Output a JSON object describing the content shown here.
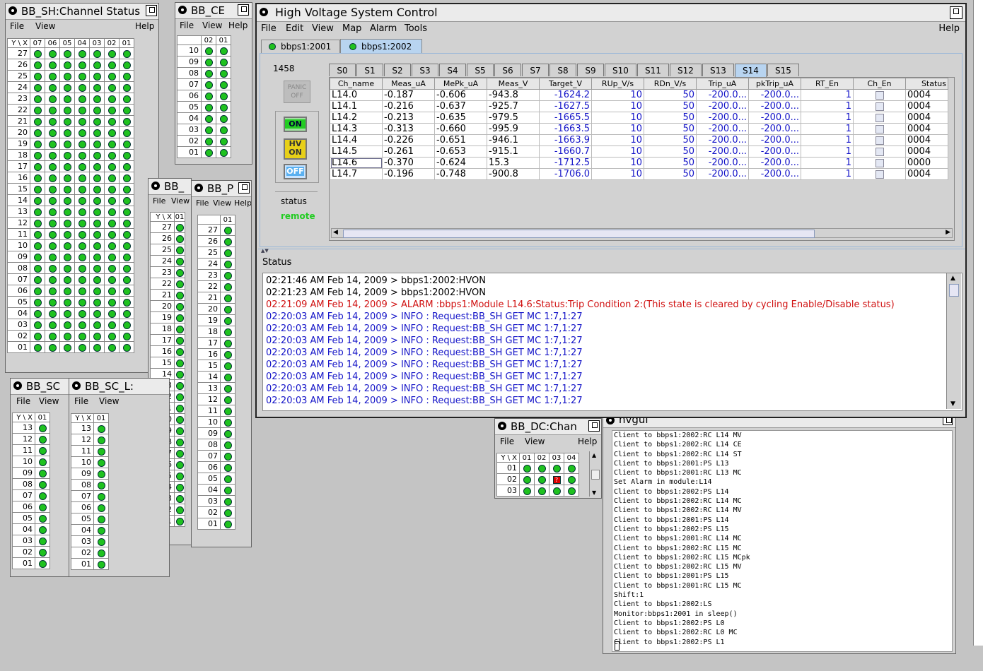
{
  "sh_window": {
    "title": "BB_SH:Channel Status",
    "menu": [
      "File",
      "View",
      "Help"
    ],
    "corner": "Y \\ X",
    "cols": [
      "07",
      "06",
      "05",
      "04",
      "03",
      "02",
      "01"
    ],
    "rows": [
      "27",
      "26",
      "25",
      "24",
      "23",
      "22",
      "21",
      "20",
      "19",
      "18",
      "17",
      "16",
      "15",
      "14",
      "13",
      "12",
      "11",
      "10",
      "09",
      "08",
      "07",
      "06",
      "05",
      "04",
      "03",
      "02",
      "01"
    ]
  },
  "ce_window": {
    "title": "BB_CE",
    "menu": [
      "File",
      "View",
      "Help"
    ],
    "cols": [
      "02",
      "01"
    ],
    "rows": [
      "10",
      "09",
      "08",
      "07",
      "06",
      "05",
      "04",
      "03",
      "02",
      "01"
    ]
  },
  "bb_a_window": {
    "title": "BB_",
    "menu": [
      "File",
      "View"
    ],
    "corner": "Y \\ X",
    "cols": [
      "01"
    ],
    "rows": [
      "27",
      "26",
      "25",
      "24",
      "23",
      "22",
      "21",
      "20",
      "19",
      "18",
      "17",
      "16",
      "15",
      "14",
      "13",
      "12",
      "11",
      "10",
      "09",
      "08",
      "07",
      "06",
      "05",
      "04",
      "03",
      "02",
      "01"
    ]
  },
  "bb_p_window": {
    "title": "BB_P",
    "menu": [
      "File",
      "View",
      "Help"
    ],
    "cols": [
      "01"
    ],
    "rows": [
      "27",
      "26",
      "25",
      "24",
      "23",
      "22",
      "21",
      "20",
      "19",
      "18",
      "17",
      "16",
      "15",
      "14",
      "13",
      "12",
      "11",
      "10",
      "09",
      "08",
      "07",
      "06",
      "05",
      "04",
      "03",
      "02",
      "01"
    ]
  },
  "sc_window": {
    "title": "BB_SC",
    "menu": [
      "File",
      "View"
    ],
    "corner": "Y \\ X",
    "cols": [
      "01"
    ],
    "rows": [
      "13",
      "12",
      "11",
      "10",
      "09",
      "08",
      "07",
      "06",
      "05",
      "04",
      "03",
      "02",
      "01"
    ]
  },
  "scl_window": {
    "title": "BB_SC_L:",
    "menu": [
      "File",
      "View"
    ],
    "corner": "Y \\ X",
    "cols": [
      "01"
    ],
    "rows": [
      "13",
      "12",
      "11",
      "10",
      "09",
      "08",
      "07",
      "06",
      "05",
      "04",
      "03",
      "02",
      "01"
    ]
  },
  "dc_window": {
    "title": "BB_DC:Chan",
    "menu": [
      "File",
      "View",
      "Help"
    ],
    "corner": "Y \\ X",
    "cols": [
      "01",
      "02",
      "03",
      "04"
    ],
    "rows": [
      "01",
      "02",
      "03"
    ],
    "fault_mark": "?"
  },
  "hvgui_window": {
    "title": "hvgui",
    "lines": [
      "Client to bbps1:2002:RC L14 MV",
      "Client to bbps1:2002:RC L14 CE",
      "Client to bbps1:2002:RC L14 ST",
      "Client to bbps1:2001:PS L13",
      "Client to bbps1:2001:RC L13 MC",
      "Set Alarm in module:L14",
      "Client to bbps1:2002:PS L14",
      "Client to bbps1:2002:RC L14 MC",
      "Client to bbps1:2002:RC L14 MV",
      "Client to bbps1:2001:PS L14",
      "Client to bbps1:2002:PS L15",
      "Client to bbps1:2001:RC L14 MC",
      "Client to bbps1:2002:RC L15 MC",
      "Client to bbps1:2002:RC L15 MCpk",
      "Client to bbps1:2002:RC L15 MV",
      "Client to bbps1:2001:PS L15",
      "Client to bbps1:2001:RC L15 MC",
      "Shift:1",
      "Client to bbps1:2002:LS",
      "Monitor:bbps1:2001 in sleep()",
      "Client to bbps1:2002:PS L0",
      "Client to bbps1:2002:RC L0 MC",
      "Client to bbps1:2002:PS L1"
    ]
  },
  "hv_window": {
    "title": "High Voltage System Control",
    "menu": [
      "File",
      "Edit",
      "View",
      "Map",
      "Alarm",
      "Tools"
    ],
    "help": "Help",
    "crate_tabs": [
      "bbps1:2001",
      "bbps1:2002"
    ],
    "crate_id": "1458",
    "panic_label": "PANIC OFF",
    "on_label": "ON",
    "hvon_label": "HV ON",
    "off_label": "OFF",
    "status_label": "status",
    "status_value": "remote",
    "slot_tabs": [
      "S0",
      "S1",
      "S2",
      "S3",
      "S4",
      "S5",
      "S6",
      "S7",
      "S8",
      "S9",
      "S10",
      "S11",
      "S12",
      "S13",
      "S14",
      "S15"
    ],
    "active_slot": "S14",
    "columns": [
      "Ch_name",
      "Meas_uA",
      "MePk_uA",
      "Meas_V",
      "Target_V",
      "RUp_V/s",
      "RDn_V/s",
      "Trip_uA",
      "pkTrip_uA",
      "RT_En",
      "Ch_En",
      "Status"
    ],
    "rows": [
      [
        "L14.0",
        "-0.187",
        "-0.606",
        "-943.8",
        "-1624.2",
        "10",
        "50",
        "-200.0...",
        "-200.0...",
        "1",
        "",
        "0004"
      ],
      [
        "L14.1",
        "-0.216",
        "-0.637",
        "-925.7",
        "-1627.5",
        "10",
        "50",
        "-200.0...",
        "-200.0...",
        "1",
        "",
        "0004"
      ],
      [
        "L14.2",
        "-0.213",
        "-0.635",
        "-979.5",
        "-1665.5",
        "10",
        "50",
        "-200.0...",
        "-200.0...",
        "1",
        "",
        "0004"
      ],
      [
        "L14.3",
        "-0.313",
        "-0.660",
        "-995.9",
        "-1663.5",
        "10",
        "50",
        "-200.0...",
        "-200.0...",
        "1",
        "",
        "0004"
      ],
      [
        "L14.4",
        "-0.226",
        "-0.651",
        "-946.1",
        "-1663.9",
        "10",
        "50",
        "-200.0...",
        "-200.0...",
        "1",
        "",
        "0004"
      ],
      [
        "L14.5",
        "-0.261",
        "-0.653",
        "-915.1",
        "-1660.7",
        "10",
        "50",
        "-200.0...",
        "-200.0...",
        "1",
        "",
        "0004"
      ],
      [
        "L14.6",
        "-0.370",
        "-0.624",
        "15.3",
        "-1712.5",
        "10",
        "50",
        "-200.0...",
        "-200.0...",
        "1",
        "",
        "0000"
      ],
      [
        "L14.7",
        "-0.196",
        "-0.748",
        "-900.8",
        "-1706.0",
        "10",
        "50",
        "-200.0...",
        "-200.0...",
        "1",
        "",
        "0004"
      ]
    ],
    "status_title": "Status",
    "log": [
      {
        "text": "02:21:46 AM Feb 14, 2009 > bbps1:2002:HVON",
        "color": "#000000"
      },
      {
        "text": "02:21:23 AM Feb 14, 2009 > bbps1:2002:HVON",
        "color": "#000000"
      },
      {
        "text": "02:21:09 AM Feb 14, 2009 > ALARM :bbps1:Module L14.6:Status:Trip Condition 2:(This state is cleared by cycling Enable/Disable status)",
        "color": "#d01010"
      },
      {
        "text": "02:20:03 AM Feb 14, 2009 > INFO : Request:BB_SH GET MC 1:7,1:27",
        "color": "#1414c8"
      },
      {
        "text": "02:20:03 AM Feb 14, 2009 > INFO : Request:BB_SH GET MC 1:7,1:27",
        "color": "#1414c8"
      },
      {
        "text": "02:20:03 AM Feb 14, 2009 > INFO : Request:BB_SH GET MC 1:7,1:27",
        "color": "#1414c8"
      },
      {
        "text": "02:20:03 AM Feb 14, 2009 > INFO : Request:BB_SH GET MC 1:7,1:27",
        "color": "#1414c8"
      },
      {
        "text": "02:20:03 AM Feb 14, 2009 > INFO : Request:BB_SH GET MC 1:7,1:27",
        "color": "#1414c8"
      },
      {
        "text": "02:20:03 AM Feb 14, 2009 > INFO : Request:BB_SH GET MC 1:7,1:27",
        "color": "#1414c8"
      },
      {
        "text": "02:20:03 AM Feb 14, 2009 > INFO : Request:BB_SH GET MC 1:7,1:27",
        "color": "#1414c8"
      },
      {
        "text": "02:20:03 AM Feb 14, 2009 > INFO : Request:BB_SH GET MC 1:7,1:27",
        "color": "#1414c8"
      }
    ],
    "colors": {
      "accent_tab": "#b8d4f0",
      "target_text": "#1414c8",
      "alarm": "#d01010",
      "ok_led": "#1fc21f",
      "status_remote": "#22cc22"
    }
  }
}
